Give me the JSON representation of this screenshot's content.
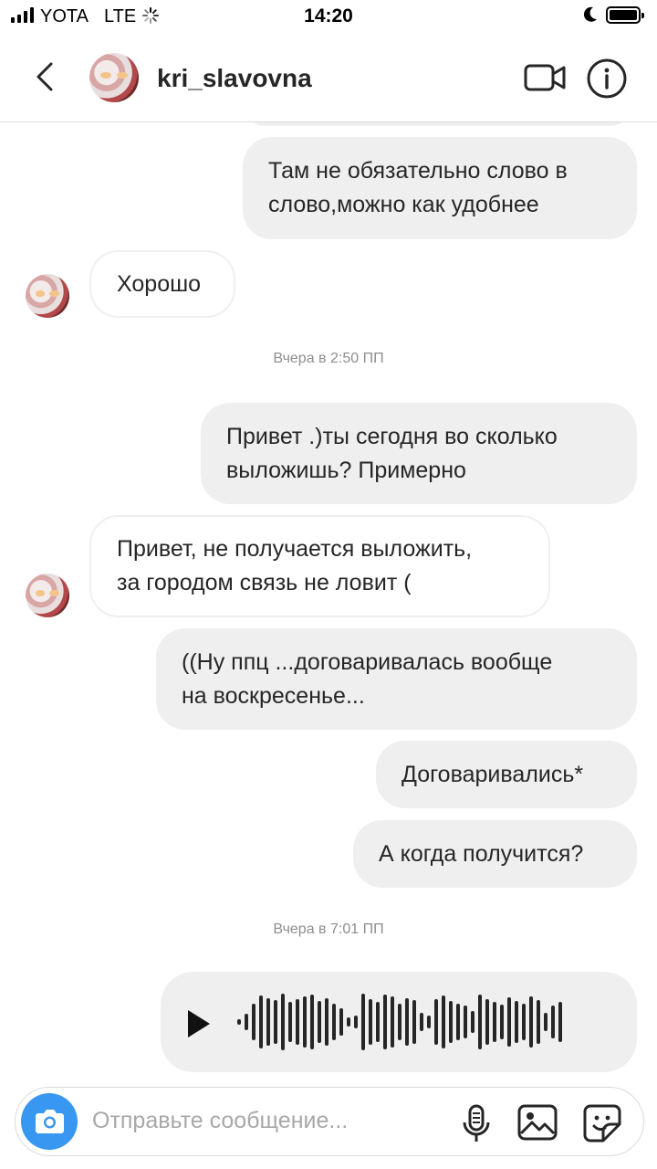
{
  "status_bar": {
    "carrier": "YOTA",
    "network": "LTE",
    "time": "14:20"
  },
  "header": {
    "username": "kri_slavovna"
  },
  "messages": [
    {
      "direction": "outgoing",
      "text": "Там не обязательно слово в\nслово,можно как удобнее"
    },
    {
      "direction": "incoming",
      "text": "Хорошо"
    },
    {
      "direction": "outgoing",
      "text": "Привет .)ты сегодня во сколько\nвыложишь? Примерно"
    },
    {
      "direction": "incoming",
      "text": "Привет, не получается выложить,\nза городом связь не ловит ("
    },
    {
      "direction": "outgoing",
      "text": "((Ну ппц ...договаривалась вообще\nна воскресенье..."
    },
    {
      "direction": "outgoing",
      "text": "Договаривались*"
    },
    {
      "direction": "outgoing",
      "text": "А когда получится?"
    }
  ],
  "timestamps": [
    "Вчера в 2:50 ПП",
    "Вчера в 7:01 ПП"
  ],
  "voice_message": {
    "type": "audio"
  },
  "composer": {
    "placeholder": "Отправьте сообщение..."
  },
  "icons": [
    "back-chevron-icon",
    "video-camera-icon",
    "info-icon",
    "camera-icon",
    "microphone-icon",
    "gallery-icon",
    "sticker-icon",
    "play-icon"
  ],
  "colors": {
    "accent": "#3897f0",
    "bubble_gray": "#efefef",
    "timestamp": "#8e8e8e"
  }
}
